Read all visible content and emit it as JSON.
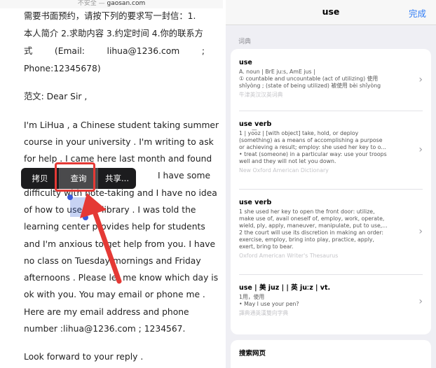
{
  "browser": {
    "insecure_label": "不安全 —",
    "domain": "gaosan.com"
  },
  "article": {
    "intro_line1": "需要书面预约，请按下列的要求写一封信：1.",
    "intro_line2": "本人简介 2.求助内容 3.约定时间 4.你的联系方",
    "intro_line3_tokens": [
      "式",
      "(Email:",
      "lihua@1236.com",
      ";"
    ],
    "intro_line4": "Phone:12345678)",
    "sample_label": "范文:  Dear Sir ,",
    "body_lines": [
      "I'm LiHua , a Chinese student taking summer",
      "course in your university . I'm writing to ask",
      "for help . I came here last month and found",
      "I have some",
      "difficulty with note-taking and I have no idea",
      "of how to use the library . I was told the",
      "learning center provides help for students",
      "and I'm anxious to get help from you. I have",
      "no class on Tuesday mornings and Friday",
      "afternoons . Please let me know which day is",
      "ok with you. You may email or phone me .",
      "Here are my email address and phone",
      "number :lihua@1236.com ; 1234567."
    ],
    "closing": "Look forward to your reply ."
  },
  "context_menu": {
    "copy": "拷贝",
    "lookup": "查询",
    "share": "共享..."
  },
  "lookup_panel": {
    "title": "use",
    "done": "完成",
    "section": "词典",
    "entries": [
      {
        "head": "use",
        "lines": [
          "A. noun | BrE juːs, AmE jus |",
          "① countable and uncountable (act of utilizing) 使用",
          "shǐyòng ; (state of being utilized) 被使用 bèi shǐyòng"
        ],
        "source": "牛津英汉汉英词典"
      },
      {
        "head": "use verb",
        "lines": [
          "1 | yo͞oz | [with object] take, hold, or deploy",
          "(something) as a means of accomplishing a purpose",
          "or achieving a result; employ: she used her key to o...",
          "• treat (someone) in a particular way: use your troops",
          "well and they will not let you down."
        ],
        "source": "New Oxford American Dictionary"
      },
      {
        "head": "use verb",
        "lines": [
          "1 she used her key to open the front door: utilize,",
          "make use of, avail oneself of, employ, work, operate,",
          "wield, ply, apply, maneuver, manipulate, put to use,...",
          "2 the court will use its discretion in making an order:",
          "exercise, employ, bring into play, practice, apply,",
          "exert, bring to bear."
        ],
        "source": "Oxford American Writer's Thesaurus"
      },
      {
        "head": "use | 美 juz | | 英 juːz | vt.",
        "lines": [
          "1用，使用",
          "• May I use your pen?"
        ],
        "source": "譯典通英漢雙向字典"
      }
    ],
    "web_search": "搜索网页"
  }
}
